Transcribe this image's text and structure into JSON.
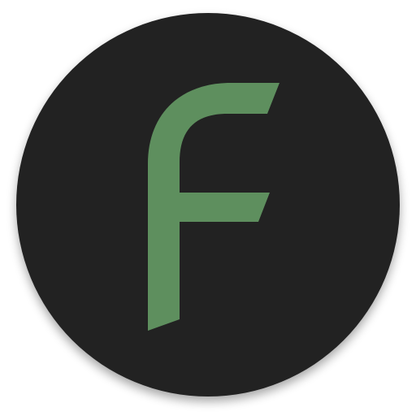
{
  "app_icon": {
    "icon_name": "letter-f-logo-icon",
    "logo_letter": "F",
    "colors": {
      "background_disc": "#212121",
      "letter_fill": "#5e8f5e",
      "page_background": "#ffffff"
    }
  }
}
